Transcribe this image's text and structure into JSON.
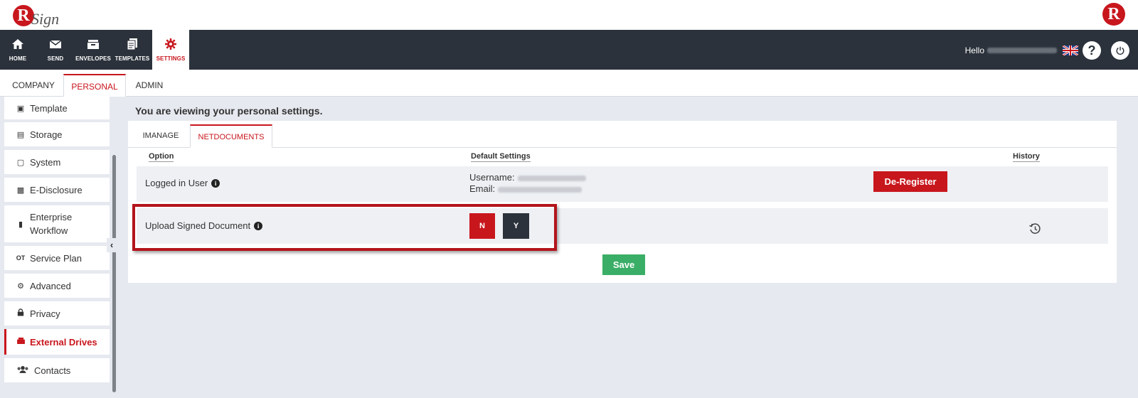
{
  "brand": {
    "logo_letter": "R",
    "logo_text": "Sign",
    "right_logo_letter": "R",
    "accent": "#c8161d"
  },
  "nav": {
    "items": [
      {
        "label": "HOME",
        "icon": "home-icon"
      },
      {
        "label": "SEND",
        "icon": "envelope-icon"
      },
      {
        "label": "ENVELOPES",
        "icon": "inbox-icon"
      },
      {
        "label": "TEMPLATES",
        "icon": "templates-icon"
      },
      {
        "label": "SETTINGS",
        "icon": "gear-icon",
        "active": true
      }
    ],
    "hello": "Hello",
    "help_glyph": "?"
  },
  "subtabs": {
    "company": "COMPANY",
    "personal": "PERSONAL",
    "admin": "ADMIN",
    "active": "PERSONAL"
  },
  "sidebar": {
    "items": [
      {
        "label": "Template",
        "icon": "template-icon"
      },
      {
        "label": "Storage",
        "icon": "storage-icon"
      },
      {
        "label": "System",
        "icon": "monitor-icon"
      },
      {
        "label": "E-Disclosure",
        "icon": "document-icon"
      },
      {
        "label": "Enterprise Workflow",
        "icon": "mobile-icon"
      },
      {
        "label": "Service Plan",
        "icon": "service-plan-icon"
      },
      {
        "label": "Advanced",
        "icon": "cogs-icon"
      },
      {
        "label": "Privacy",
        "icon": "lock-icon"
      },
      {
        "label": "External Drives",
        "icon": "drive-icon",
        "active": true
      },
      {
        "label": "Contacts",
        "icon": "contacts-icon"
      }
    ]
  },
  "main": {
    "viewing_text": "You are viewing your personal settings.",
    "tabs": [
      {
        "label": "IMANAGE"
      },
      {
        "label": "NETDOCUMENTS",
        "active": true
      }
    ],
    "columns": {
      "option": "Option",
      "default": "Default Settings",
      "history": "History"
    },
    "rows": {
      "logged_in": {
        "label": "Logged in User",
        "username_label": "Username:",
        "email_label": "Email:",
        "deregister_label": "De-Register"
      },
      "upload_signed": {
        "label": "Upload Signed Document",
        "n_label": "N",
        "y_label": "Y",
        "selected": "N"
      }
    },
    "save_label": "Save"
  },
  "colors": {
    "nav_bg": "#2b323b",
    "save_green": "#3aae66",
    "content_bg": "#e6e9ef"
  }
}
